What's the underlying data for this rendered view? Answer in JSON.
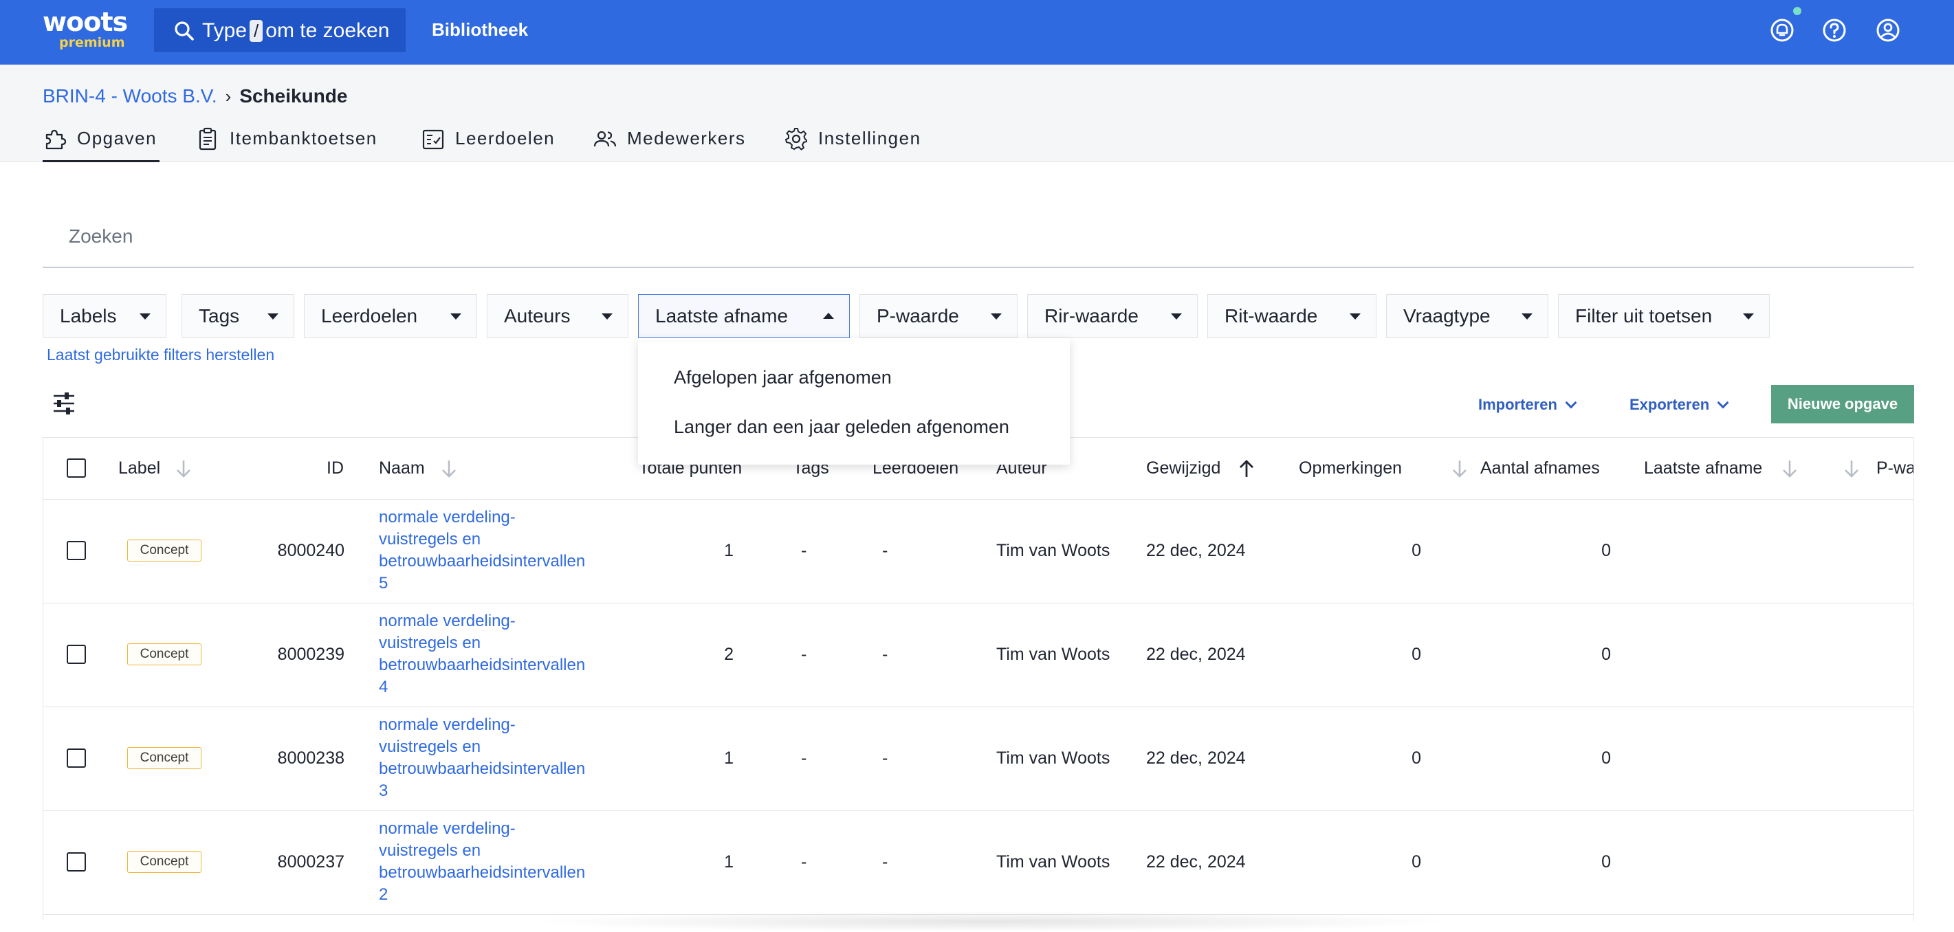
{
  "app": {
    "logo_text": "woots",
    "logo_subtext": "premium",
    "search_prefix": "Type",
    "search_key": "/",
    "search_suffix": "om te zoeken",
    "library_link": "Bibliotheek",
    "icons": [
      "notifications-icon",
      "help-icon",
      "account-icon"
    ],
    "accent_color": "#2f6ae1"
  },
  "breadcrumb": {
    "parent": "BRIN-4 - Woots B.V.",
    "current": "Scheikunde"
  },
  "tabs": [
    {
      "label": "Opgaven",
      "icon": "puzzle-icon",
      "active": true
    },
    {
      "label": "Itembanktoetsen",
      "icon": "clipboard-icon",
      "active": false
    },
    {
      "label": "Leerdoelen",
      "icon": "checklist-icon",
      "active": false
    },
    {
      "label": "Medewerkers",
      "icon": "people-icon",
      "active": false
    },
    {
      "label": "Instellingen",
      "icon": "gear-icon",
      "active": false
    }
  ],
  "search": {
    "placeholder": "Zoeken",
    "value": ""
  },
  "filters": [
    {
      "label": "Labels"
    },
    {
      "label": "Tags"
    },
    {
      "label": "Leerdoelen"
    },
    {
      "label": "Auteurs"
    },
    {
      "label": "Laatste afname",
      "open": true
    },
    {
      "label": "P-waarde"
    },
    {
      "label": "Rir-waarde"
    },
    {
      "label": "Rit-waarde"
    },
    {
      "label": "Vraagtype"
    },
    {
      "label": "Filter uit toetsen"
    }
  ],
  "restore_filters": "Laatst gebruikte filters herstellen",
  "dropdown_options": [
    "Afgelopen jaar afgenomen",
    "Langer dan een jaar geleden afgenomen"
  ],
  "actions": {
    "import_label": "Importeren",
    "export_label": "Exporteren",
    "new_label": "Nieuwe opgave"
  },
  "table": {
    "columns": {
      "label": "Label",
      "id": "ID",
      "name": "Naam",
      "points": "Totale punten",
      "tags": "Tags",
      "goals": "Leerdoelen",
      "author": "Auteur",
      "modified": "Gewijzigd",
      "remarks": "Opmerkingen",
      "attempts": "Aantal afnames",
      "last": "Laatste afname",
      "pvalue": "P-wa"
    },
    "rows": [
      {
        "label": "Concept",
        "id": "8000240",
        "name_lines": [
          "normale verdeling-",
          "vuistregels en",
          "betrouwbaarheidsintervallen",
          "5"
        ],
        "points": "1",
        "tags": "-",
        "goals": "-",
        "author": "Tim van Woots",
        "modified": "22 dec, 2024",
        "remarks": "0",
        "attempts": "0"
      },
      {
        "label": "Concept",
        "id": "8000239",
        "name_lines": [
          "normale verdeling-",
          "vuistregels en",
          "betrouwbaarheidsintervallen",
          "4"
        ],
        "points": "2",
        "tags": "-",
        "goals": "-",
        "author": "Tim van Woots",
        "modified": "22 dec, 2024",
        "remarks": "0",
        "attempts": "0"
      },
      {
        "label": "Concept",
        "id": "8000238",
        "name_lines": [
          "normale verdeling-",
          "vuistregels en",
          "betrouwbaarheidsintervallen",
          "3"
        ],
        "points": "1",
        "tags": "-",
        "goals": "-",
        "author": "Tim van Woots",
        "modified": "22 dec, 2024",
        "remarks": "0",
        "attempts": "0"
      },
      {
        "label": "Concept",
        "id": "8000237",
        "name_lines": [
          "normale verdeling-",
          "vuistregels en",
          "betrouwbaarheidsintervallen",
          "2"
        ],
        "points": "1",
        "tags": "-",
        "goals": "-",
        "author": "Tim van Woots",
        "modified": "22 dec, 2024",
        "remarks": "0",
        "attempts": "0"
      }
    ]
  }
}
